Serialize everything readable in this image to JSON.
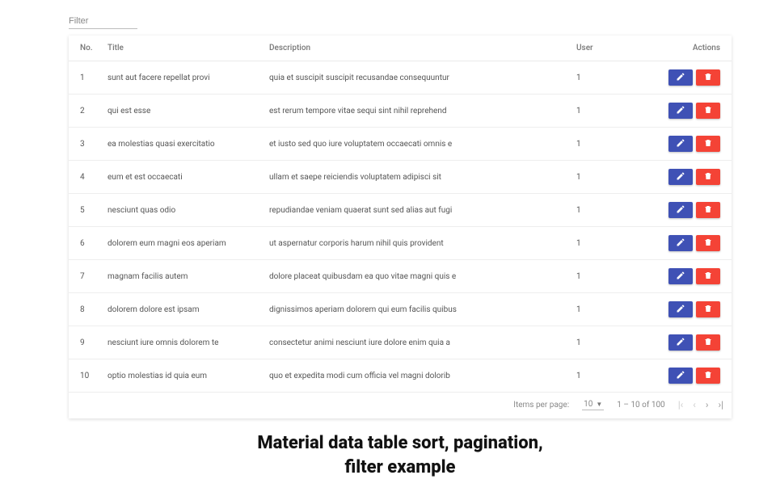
{
  "filter": {
    "placeholder": "Filter"
  },
  "columns": {
    "no": "No.",
    "title": "Title",
    "description": "Description",
    "user": "User",
    "actions": "Actions"
  },
  "rows": [
    {
      "no": "1",
      "title": "sunt aut facere repellat provi",
      "description": "quia et suscipit suscipit recusandae consequuntur",
      "user": "1"
    },
    {
      "no": "2",
      "title": "qui est esse",
      "description": "est rerum tempore vitae sequi sint nihil reprehend",
      "user": "1"
    },
    {
      "no": "3",
      "title": "ea molestias quasi exercitatio",
      "description": "et iusto sed quo iure voluptatem occaecati omnis e",
      "user": "1"
    },
    {
      "no": "4",
      "title": "eum et est occaecati",
      "description": "ullam et saepe reiciendis voluptatem adipisci sit",
      "user": "1"
    },
    {
      "no": "5",
      "title": "nesciunt quas odio",
      "description": "repudiandae veniam quaerat sunt sed alias aut fugi",
      "user": "1"
    },
    {
      "no": "6",
      "title": "dolorem eum magni eos aperiam",
      "description": "ut aspernatur corporis harum nihil quis provident",
      "user": "1"
    },
    {
      "no": "7",
      "title": "magnam facilis autem",
      "description": "dolore placeat quibusdam ea quo vitae magni quis e",
      "user": "1"
    },
    {
      "no": "8",
      "title": "dolorem dolore est ipsam",
      "description": "dignissimos aperiam dolorem qui eum facilis quibus",
      "user": "1"
    },
    {
      "no": "9",
      "title": "nesciunt iure omnis dolorem te",
      "description": "consectetur animi nesciunt iure dolore enim quia a",
      "user": "1"
    },
    {
      "no": "10",
      "title": "optio molestias id quia eum",
      "description": "quo et expedita modi cum officia vel magni dolorib",
      "user": "1"
    }
  ],
  "paginator": {
    "items_per_page_label": "Items per page:",
    "page_size": "10",
    "range_label": "1 – 10 of 100"
  },
  "caption": {
    "line1": "Material data table sort, pagination,",
    "line2": "filter example"
  }
}
